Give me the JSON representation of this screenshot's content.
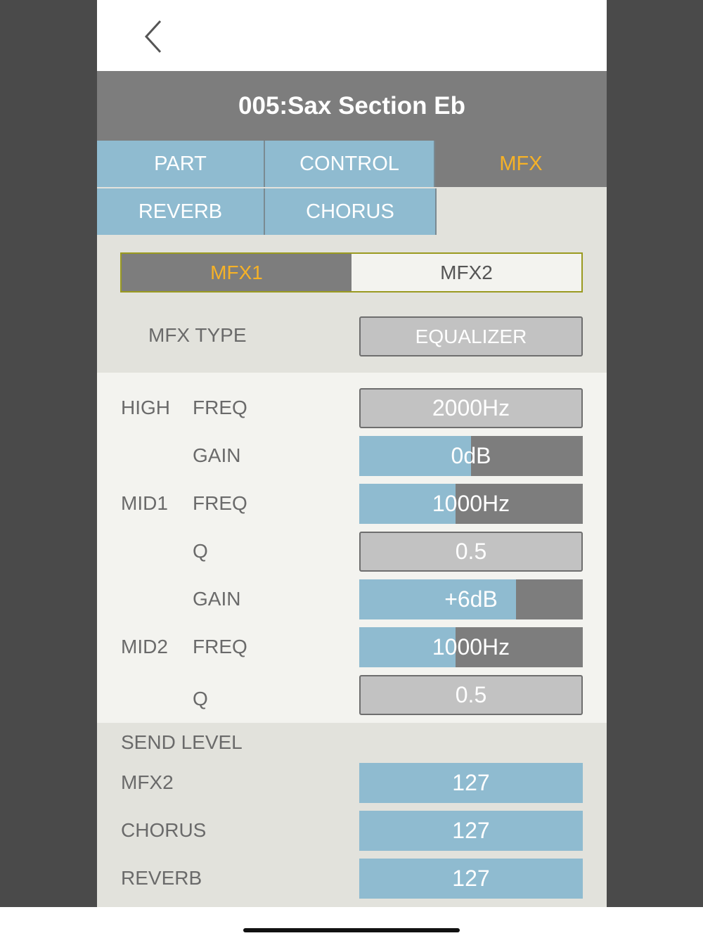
{
  "nav": {
    "back_icon": "chevron-left-icon"
  },
  "title": "005:Sax Section Eb",
  "tabs": [
    {
      "label": "PART"
    },
    {
      "label": "CONTROL"
    },
    {
      "label": "MFX",
      "active": true
    },
    {
      "label": "REVERB"
    },
    {
      "label": "CHORUS"
    }
  ],
  "mfx_selector": {
    "options": [
      "MFX1",
      "MFX2"
    ],
    "selected": "MFX1"
  },
  "mfx_type": {
    "label": "MFX TYPE",
    "value": "EQUALIZER"
  },
  "params": {
    "high_group": "HIGH",
    "mid1_group": "MID1",
    "mid2_group": "MID2",
    "high_freq": {
      "label": "FREQ",
      "value": "2000Hz"
    },
    "high_gain": {
      "label": "GAIN",
      "value": "0dB",
      "level": 0.5
    },
    "mid1_freq": {
      "label": "FREQ",
      "value": "1000Hz",
      "level": 0.43
    },
    "mid1_q": {
      "label": "Q",
      "value": "0.5"
    },
    "mid1_gain": {
      "label": "GAIN",
      "value": "+6dB",
      "level": 0.7
    },
    "mid2_freq": {
      "label": "FREQ",
      "value": "1000Hz",
      "level": 0.43
    },
    "mid2_q": {
      "label": "Q",
      "value": "0.5"
    }
  },
  "send_level": {
    "heading": "SEND LEVEL",
    "mfx2": {
      "label": "MFX2",
      "value": "127",
      "level": 1.0
    },
    "chorus": {
      "label": "CHORUS",
      "value": "127",
      "level": 1.0
    },
    "reverb": {
      "label": "REVERB",
      "value": "127",
      "level": 1.0
    }
  },
  "colors": {
    "accent": "#f6b227",
    "tab_blue": "#8fbbd0",
    "header_gray": "#7d7d7d"
  }
}
